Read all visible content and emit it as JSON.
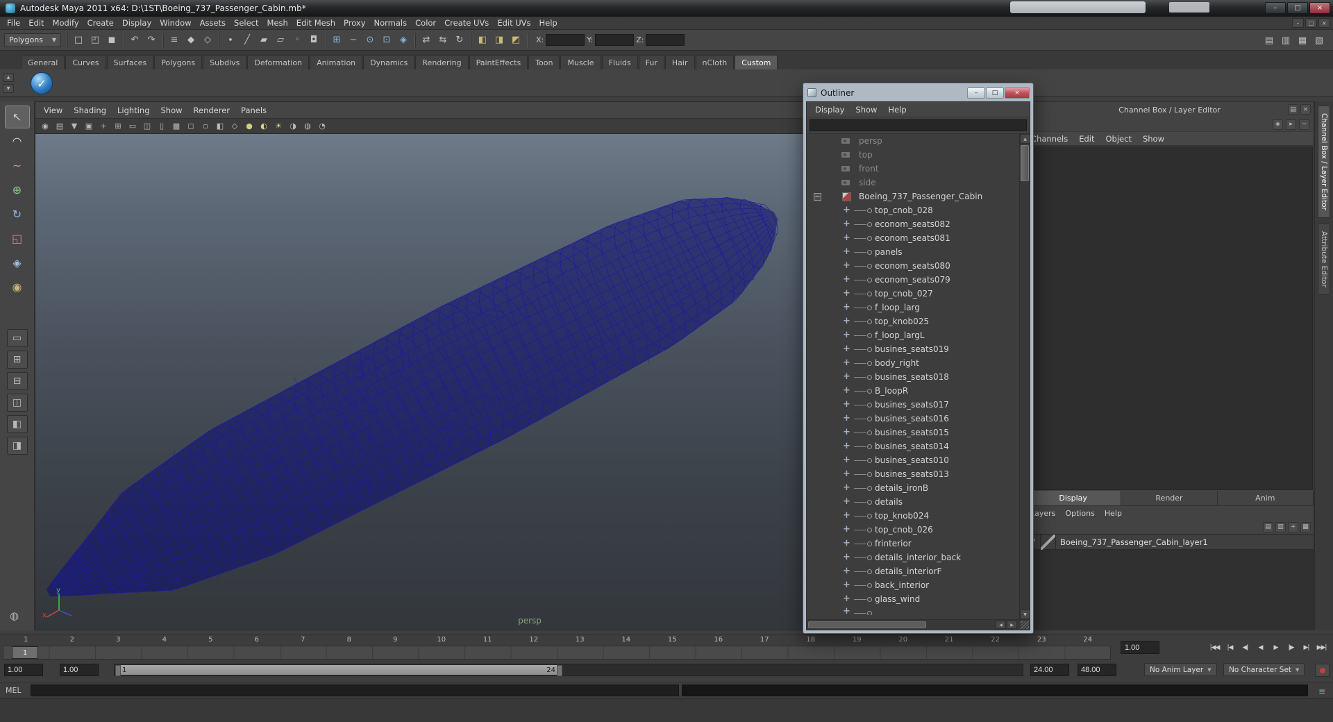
{
  "window": {
    "title": "Autodesk Maya 2011 x64: D:\\1ST\\Boeing_737_Passenger_Cabin.mb*",
    "buttons": [
      {
        "name": "window-minimize-button",
        "glyph": "–"
      },
      {
        "name": "window-maximize-button",
        "glyph": "□"
      },
      {
        "name": "window-close-button",
        "glyph": "×",
        "cls": "close"
      }
    ],
    "mdi_buttons": [
      {
        "name": "child-minimize-button",
        "glyph": "–"
      },
      {
        "name": "child-restore-button",
        "glyph": "□"
      },
      {
        "name": "child-close-button",
        "glyph": "×"
      }
    ]
  },
  "menu_bar": {
    "items": [
      "File",
      "Edit",
      "Modify",
      "Create",
      "Display",
      "Window",
      "Assets",
      "Select",
      "Mesh",
      "Edit Mesh",
      "Proxy",
      "Normals",
      "Color",
      "Create UVs",
      "Edit UVs",
      "Help"
    ]
  },
  "status_line": {
    "menuset": "Polygons",
    "x_label": "X:",
    "y_label": "Y:",
    "z_label": "Z:",
    "x_value": "",
    "y_value": "",
    "z_value": "",
    "icons": [
      {
        "name": "separator",
        "cls": "sep",
        "sep": true
      },
      {
        "name": "new-scene-icon",
        "glyph": "□"
      },
      {
        "name": "open-scene-icon",
        "glyph": "◰"
      },
      {
        "name": "save-scene-icon",
        "glyph": "◼"
      },
      {
        "name": "separator",
        "cls": "sep",
        "sep": true
      },
      {
        "name": "undo-icon",
        "glyph": "↶"
      },
      {
        "name": "redo-icon",
        "glyph": "↷"
      },
      {
        "name": "separator",
        "cls": "sep",
        "sep": true
      },
      {
        "name": "select-hierarchy-icon",
        "glyph": "≡"
      },
      {
        "name": "select-object-icon",
        "glyph": "◆"
      },
      {
        "name": "select-component-icon",
        "glyph": "◇"
      },
      {
        "name": "separator",
        "cls": "sep",
        "sep": true
      },
      {
        "name": "mask-points-icon",
        "glyph": "∙"
      },
      {
        "name": "mask-curves-icon",
        "glyph": "╱"
      },
      {
        "name": "mask-surfaces-icon",
        "glyph": "▰"
      },
      {
        "name": "mask-deformations-icon",
        "glyph": "▱"
      },
      {
        "name": "mask-dynamics-icon",
        "glyph": "◦"
      },
      {
        "name": "mask-rendering-icon",
        "glyph": "◘"
      },
      {
        "name": "separator",
        "cls": "sep",
        "sep": true
      },
      {
        "name": "snap-grid-icon",
        "glyph": "⊞",
        "color": "#86b7e0"
      },
      {
        "name": "snap-curve-icon",
        "glyph": "~",
        "color": "#86b7e0"
      },
      {
        "name": "snap-point-icon",
        "glyph": "⊙",
        "color": "#86b7e0"
      },
      {
        "name": "snap-plane-icon",
        "glyph": "⊡",
        "color": "#86b7e0"
      },
      {
        "name": "make-live-icon",
        "glyph": "◈",
        "color": "#86b7e0"
      },
      {
        "name": "separator",
        "cls": "sep",
        "sep": true
      },
      {
        "name": "input-connections-icon",
        "glyph": "⇄"
      },
      {
        "name": "output-connections-icon",
        "glyph": "⇆"
      },
      {
        "name": "construction-history-icon",
        "glyph": "↻"
      },
      {
        "name": "separator",
        "cls": "sep",
        "sep": true
      },
      {
        "name": "render-icon",
        "glyph": "◧",
        "color": "#c9b97a"
      },
      {
        "name": "ipr-render-icon",
        "glyph": "◨",
        "color": "#c9b97a"
      },
      {
        "name": "render-settings-icon",
        "glyph": "◩",
        "color": "#c9b97a"
      },
      {
        "name": "separator",
        "cls": "sep",
        "sep": true
      }
    ],
    "right_icons": [
      {
        "name": "show-grid-toggle-icon",
        "glyph": "▤"
      },
      {
        "name": "show-attribute-editor-icon",
        "glyph": "▥"
      },
      {
        "name": "show-tool-settings-icon",
        "glyph": "▦"
      },
      {
        "name": "show-channel-box-icon",
        "glyph": "▧"
      }
    ]
  },
  "shelf": {
    "tabs": [
      {
        "label": "General"
      },
      {
        "label": "Curves"
      },
      {
        "label": "Surfaces"
      },
      {
        "label": "Polygons"
      },
      {
        "label": "Subdivs"
      },
      {
        "label": "Deformation"
      },
      {
        "label": "Animation"
      },
      {
        "label": "Dynamics"
      },
      {
        "label": "Rendering"
      },
      {
        "label": "PaintEffects"
      },
      {
        "label": "Toon"
      },
      {
        "label": "Muscle"
      },
      {
        "label": "Fluids"
      },
      {
        "label": "Fur"
      },
      {
        "label": "Hair"
      },
      {
        "label": "nCloth"
      },
      {
        "label": "Custom",
        "active": true
      }
    ],
    "side_buttons": [
      {
        "name": "shelf-tab-cycle-button",
        "glyph": "▲"
      },
      {
        "name": "shelf-menu-button",
        "glyph": "▼"
      }
    ],
    "items": [
      {
        "name": "custom-shelf-script-button",
        "glyph": "✓"
      }
    ]
  },
  "toolbox": {
    "tools": [
      {
        "name": "select-tool",
        "glyph": "↖",
        "cls": "active"
      },
      {
        "name": "lasso-select-tool",
        "glyph": "◠"
      },
      {
        "name": "paint-selection-tool",
        "glyph": "~",
        "color": "#d98f8f"
      },
      {
        "name": "move-tool",
        "glyph": "⊕",
        "color": "#8fd08f"
      },
      {
        "name": "rotate-tool",
        "glyph": "↻",
        "color": "#8fb7e8"
      },
      {
        "name": "scale-tool",
        "glyph": "◱",
        "color": "#d08f8f"
      },
      {
        "name": "universal-manipulator-tool",
        "glyph": "◈",
        "color": "#9fc4e8"
      },
      {
        "name": "soft-modification-tool",
        "glyph": "◉",
        "color": "#c8b47a"
      }
    ],
    "layouts": [
      {
        "name": "layout-single-pane-button",
        "glyph": "▭"
      },
      {
        "name": "layout-four-pane-button",
        "glyph": "⊞"
      },
      {
        "name": "layout-two-stacked-button",
        "glyph": "⊟"
      },
      {
        "name": "layout-two-side-button",
        "glyph": "◫"
      },
      {
        "name": "layout-persp-outliner-button",
        "glyph": "◧"
      },
      {
        "name": "layout-split-button",
        "glyph": "◨"
      }
    ],
    "extra_icon": {
      "glyph": "◍"
    }
  },
  "viewport": {
    "menus": [
      "View",
      "Shading",
      "Lighting",
      "Show",
      "Renderer",
      "Panels"
    ],
    "icons": [
      {
        "name": "select-camera-icon",
        "glyph": "◉"
      },
      {
        "name": "camera-attributes-icon",
        "glyph": "▤"
      },
      {
        "name": "bookmark-icon",
        "glyph": "▼"
      },
      {
        "name": "image-plane-icon",
        "glyph": "▣"
      },
      {
        "name": "2d-pan-zoom-icon",
        "glyph": "+"
      },
      {
        "name": "grid-icon",
        "glyph": "⊞"
      },
      {
        "name": "film-gate-icon",
        "glyph": "▭"
      },
      {
        "name": "resolution-gate-icon",
        "glyph": "◫"
      },
      {
        "name": "gate-mask-icon",
        "glyph": "▯"
      },
      {
        "name": "field-chart-icon",
        "glyph": "▩"
      },
      {
        "name": "safe-action-icon",
        "glyph": "◻"
      },
      {
        "name": "safe-title-icon",
        "glyph": "▫"
      },
      {
        "name": "fill-mode-icon",
        "glyph": "◧"
      },
      {
        "name": "wireframe-mode-icon",
        "glyph": "◇"
      },
      {
        "name": "shaded-mode-icon",
        "glyph": "●",
        "color": "#cfcf80"
      },
      {
        "name": "textured-mode-icon",
        "glyph": "◐",
        "color": "#e0d080"
      },
      {
        "name": "lighting-icon",
        "glyph": "☀",
        "color": "#e0d080"
      },
      {
        "name": "shadows-icon",
        "glyph": "◑"
      },
      {
        "name": "xray-icon",
        "glyph": "◍"
      },
      {
        "name": "isolate-select-icon",
        "glyph": "◔"
      }
    ],
    "camera_label": "persp",
    "axis_x": "x",
    "axis_y": "y",
    "model": {
      "stroke": "#1c1ca0",
      "fill": "#0b0b72"
    }
  },
  "outliner": {
    "title": "Outliner",
    "buttons": [
      {
        "name": "outliner-minimize-button",
        "glyph": "–"
      },
      {
        "name": "outliner-maximize-button",
        "glyph": "□"
      },
      {
        "name": "outliner-close-button",
        "glyph": "×",
        "cls": "close"
      }
    ],
    "menus": [
      "Display",
      "Show",
      "Help"
    ],
    "filter_value": "",
    "items": [
      {
        "label": "persp",
        "icon": "camera",
        "cls": "disabled"
      },
      {
        "label": "top",
        "icon": "camera",
        "cls": "disabled"
      },
      {
        "label": "front",
        "icon": "camera",
        "cls": "disabled"
      },
      {
        "label": "side",
        "icon": "camera",
        "cls": "disabled"
      },
      {
        "label": "Boeing_737_Passenger_Cabin",
        "icon": "group",
        "cls": "root",
        "expander": "−"
      },
      {
        "label": "top_cnob_028",
        "icon": "transform",
        "cls": "child"
      },
      {
        "label": "econom_seats082",
        "icon": "transform",
        "cls": "child"
      },
      {
        "label": "econom_seats081",
        "icon": "transform",
        "cls": "child"
      },
      {
        "label": "panels",
        "icon": "transform",
        "cls": "child"
      },
      {
        "label": "econom_seats080",
        "icon": "transform",
        "cls": "child"
      },
      {
        "label": "econom_seats079",
        "icon": "transform",
        "cls": "child"
      },
      {
        "label": "top_cnob_027",
        "icon": "transform",
        "cls": "child"
      },
      {
        "label": "f_loop_larg",
        "icon": "transform",
        "cls": "child"
      },
      {
        "label": "top_knob025",
        "icon": "transform",
        "cls": "child"
      },
      {
        "label": "f_loop_largL",
        "icon": "transform",
        "cls": "child"
      },
      {
        "label": "busines_seats019",
        "icon": "transform",
        "cls": "child"
      },
      {
        "label": "body_right",
        "icon": "transform",
        "cls": "child"
      },
      {
        "label": "busines_seats018",
        "icon": "transform",
        "cls": "child"
      },
      {
        "label": "B_loopR",
        "icon": "transform",
        "cls": "child"
      },
      {
        "label": "busines_seats017",
        "icon": "transform",
        "cls": "child"
      },
      {
        "label": "busines_seats016",
        "icon": "transform",
        "cls": "child"
      },
      {
        "label": "busines_seats015",
        "icon": "transform",
        "cls": "child"
      },
      {
        "label": "busines_seats014",
        "icon": "transform",
        "cls": "child"
      },
      {
        "label": "busines_seats010",
        "icon": "transform",
        "cls": "child"
      },
      {
        "label": "busines_seats013",
        "icon": "transform",
        "cls": "child"
      },
      {
        "label": "details_ironB",
        "icon": "transform",
        "cls": "child"
      },
      {
        "label": "details",
        "icon": "transform",
        "cls": "child"
      },
      {
        "label": "top_knob024",
        "icon": "transform",
        "cls": "child"
      },
      {
        "label": "top_cnob_026",
        "icon": "transform",
        "cls": "child"
      },
      {
        "label": "frinterior",
        "icon": "transform",
        "cls": "child"
      },
      {
        "label": "details_interior_back",
        "icon": "transform",
        "cls": "child"
      },
      {
        "label": "details_interiorF",
        "icon": "transform",
        "cls": "child"
      },
      {
        "label": "back_interior",
        "icon": "transform",
        "cls": "child"
      },
      {
        "label": "glass_wind",
        "icon": "transform",
        "cls": "child"
      },
      {
        "label": "",
        "icon": "transform",
        "cls": "child partial"
      }
    ]
  },
  "channel_box": {
    "header": "Channel Box / Layer Editor",
    "header_icons": [
      {
        "name": "panel-menu-icon",
        "glyph": "▤"
      },
      {
        "name": "panel-close-icon",
        "glyph": "×"
      }
    ],
    "sub_icons": [
      {
        "name": "manip-mode-icon",
        "glyph": "◈"
      },
      {
        "name": "speed-mode-icon",
        "glyph": "▸"
      },
      {
        "name": "hyperbolic-mode-icon",
        "glyph": "~"
      }
    ],
    "menus": [
      "Channels",
      "Edit",
      "Object",
      "Show"
    ],
    "layer_editor": {
      "tabs": [
        {
          "label": "Display",
          "active": true
        },
        {
          "label": "Render"
        },
        {
          "label": "Anim"
        }
      ],
      "menus": [
        "Layers",
        "Options",
        "Help"
      ],
      "icons": [
        {
          "name": "move-layer-up-icon",
          "glyph": "▤"
        },
        {
          "name": "move-layer-down-icon",
          "glyph": "▥"
        },
        {
          "name": "create-empty-layer-icon",
          "glyph": "+"
        },
        {
          "name": "create-layer-from-selected-icon",
          "glyph": "▦"
        }
      ],
      "layers": [
        {
          "name_attr": "layer-row",
          "visibility": "V",
          "name": "Boeing_737_Passenger_Cabin_layer1"
        }
      ]
    }
  },
  "right_tabs": [
    {
      "label": "Channel Box / Layer Editor",
      "active": true
    },
    {
      "label": "Attribute Editor"
    }
  ],
  "timeline": {
    "ticks": [
      "1",
      "2",
      "3",
      "4",
      "5",
      "6",
      "7",
      "8",
      "9",
      "10",
      "11",
      "12",
      "13",
      "14",
      "15",
      "16",
      "17",
      "18",
      "19",
      "20",
      "21",
      "22",
      "23",
      "24"
    ],
    "current_frame": "1",
    "current_frame_field": "1.00",
    "playback_buttons": [
      {
        "name": "go-to-start-button",
        "glyph": "|◀◀"
      },
      {
        "name": "step-back-frame-button",
        "glyph": "|◀"
      },
      {
        "name": "step-back-key-button",
        "glyph": "◀|"
      },
      {
        "name": "play-backwards-button",
        "glyph": "◀"
      },
      {
        "name": "play-forwards-button",
        "glyph": "▶"
      },
      {
        "name": "step-forward-key-button",
        "glyph": "|▶"
      },
      {
        "name": "step-forward-frame-button",
        "glyph": "▶|"
      },
      {
        "name": "go-to-end-button",
        "glyph": "▶▶|"
      }
    ]
  },
  "range_slider": {
    "anim_start": "1.00",
    "playback_start": "1.00",
    "range_start_label": "1",
    "range_end_label": "24",
    "playback_end": "24.00",
    "anim_end": "48.00",
    "anim_layer": "No Anim Layer",
    "character_set": "No Character Set"
  },
  "command_line": {
    "label": "MEL",
    "input_value": "",
    "result_value": ""
  }
}
